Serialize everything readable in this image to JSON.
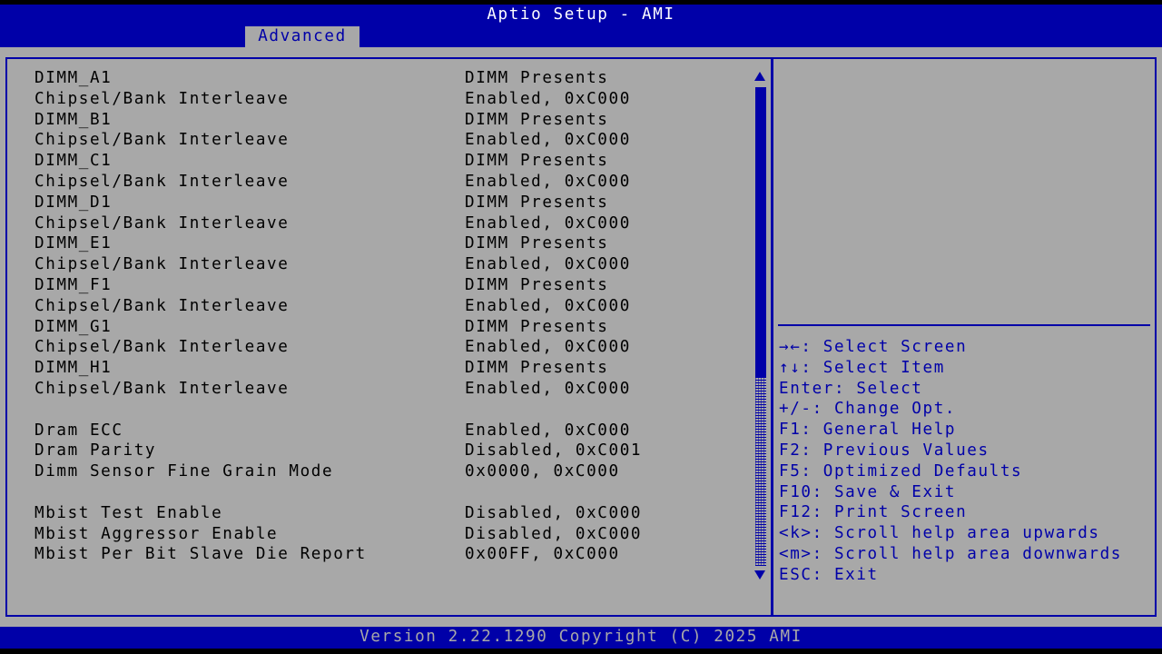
{
  "header": {
    "title": "Aptio Setup - AMI",
    "tabs": [
      {
        "label": "Advanced",
        "active": true
      }
    ]
  },
  "settings": [
    {
      "label": "DIMM_A1",
      "value": "DIMM Presents"
    },
    {
      "label": "Chipsel/Bank Interleave",
      "value": "Enabled, 0xC000"
    },
    {
      "label": "DIMM_B1",
      "value": "DIMM Presents"
    },
    {
      "label": "Chipsel/Bank Interleave",
      "value": "Enabled, 0xC000"
    },
    {
      "label": "DIMM_C1",
      "value": "DIMM Presents"
    },
    {
      "label": "Chipsel/Bank Interleave",
      "value": "Enabled, 0xC000"
    },
    {
      "label": "DIMM_D1",
      "value": "DIMM Presents"
    },
    {
      "label": "Chipsel/Bank Interleave",
      "value": "Enabled, 0xC000"
    },
    {
      "label": "DIMM_E1",
      "value": "DIMM Presents"
    },
    {
      "label": "Chipsel/Bank Interleave",
      "value": "Enabled, 0xC000"
    },
    {
      "label": "DIMM_F1",
      "value": "DIMM Presents"
    },
    {
      "label": "Chipsel/Bank Interleave",
      "value": "Enabled, 0xC000"
    },
    {
      "label": "DIMM_G1",
      "value": "DIMM Presents"
    },
    {
      "label": "Chipsel/Bank Interleave",
      "value": "Enabled, 0xC000"
    },
    {
      "label": "DIMM_H1",
      "value": "DIMM Presents"
    },
    {
      "label": "Chipsel/Bank Interleave",
      "value": "Enabled, 0xC000"
    },
    {
      "label": "Dram ECC",
      "value": "Enabled, 0xC000"
    },
    {
      "label": "Dram Parity",
      "value": "Disabled, 0xC001"
    },
    {
      "label": "Dimm Sensor Fine Grain Mode",
      "value": "0x0000, 0xC000"
    },
    {
      "label": "Mbist Test Enable",
      "value": "Disabled, 0xC000"
    },
    {
      "label": "Mbist Aggressor Enable",
      "value": "Disabled, 0xC000"
    },
    {
      "label": "Mbist Per Bit Slave Die Report",
      "value": "0x00FF, 0xC000"
    }
  ],
  "help": [
    "→←: Select Screen",
    "↑↓: Select Item",
    "Enter: Select",
    "+/-: Change Opt.",
    "F1: General Help",
    "F2: Previous Values",
    "F5: Optimized Defaults",
    "F10: Save & Exit",
    "F12: Print Screen",
    "<k>: Scroll help area upwards",
    "<m>: Scroll help area downwards",
    "ESC: Exit"
  ],
  "scrollbar": {
    "up_icon": "arrow-up-icon",
    "down_icon": "arrow-down-icon",
    "position_fraction": 0.0
  },
  "footer": {
    "text": "Version 2.22.1290 Copyright (C) 2025 AMI"
  },
  "colors": {
    "bios_blue": "#0000a8",
    "bios_gray": "#a8a8a8",
    "text_black": "#000000",
    "text_white": "#ffffff"
  }
}
